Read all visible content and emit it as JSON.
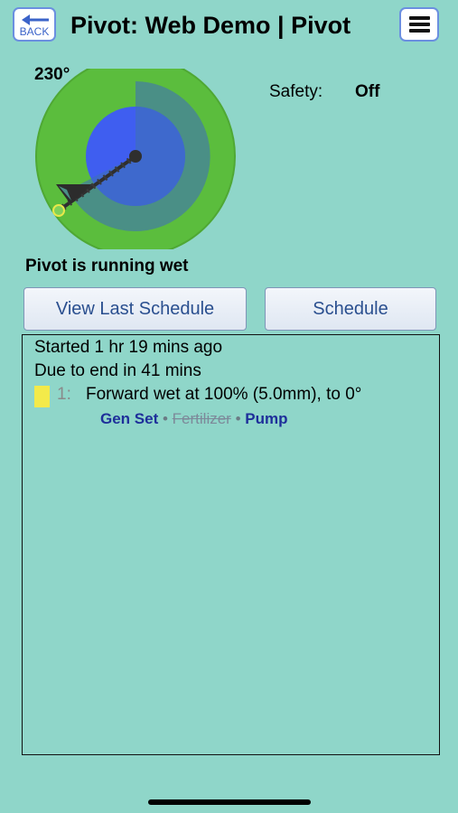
{
  "header": {
    "back_label": "BACK",
    "title": "Pivot: Web Demo | Pivot"
  },
  "pivot": {
    "angle": "230°",
    "safety_label": "Safety:",
    "safety_value": "Off",
    "status": "Pivot is running wet",
    "colors": {
      "outer_ring": "#5bbd3d",
      "outer_field": "#4a8f86",
      "inner_ring": "#3f5ef0",
      "inner_field": "#3d7e8c"
    }
  },
  "buttons": {
    "view_last_schedule": "View Last Schedule",
    "schedule": "Schedule"
  },
  "schedule": {
    "started": "Started 1 hr 19 mins ago",
    "due": "Due to end in 41 mins",
    "steps": [
      {
        "number": "1:",
        "description": "Forward wet at 100% (5.0mm), to 0°",
        "marker_color": "#f3ea4a",
        "equipment": [
          {
            "name": "Gen Set",
            "active": true
          },
          {
            "name": "Fertilizer",
            "active": false
          },
          {
            "name": "Pump",
            "active": true
          }
        ],
        "separator": "•"
      }
    ]
  }
}
